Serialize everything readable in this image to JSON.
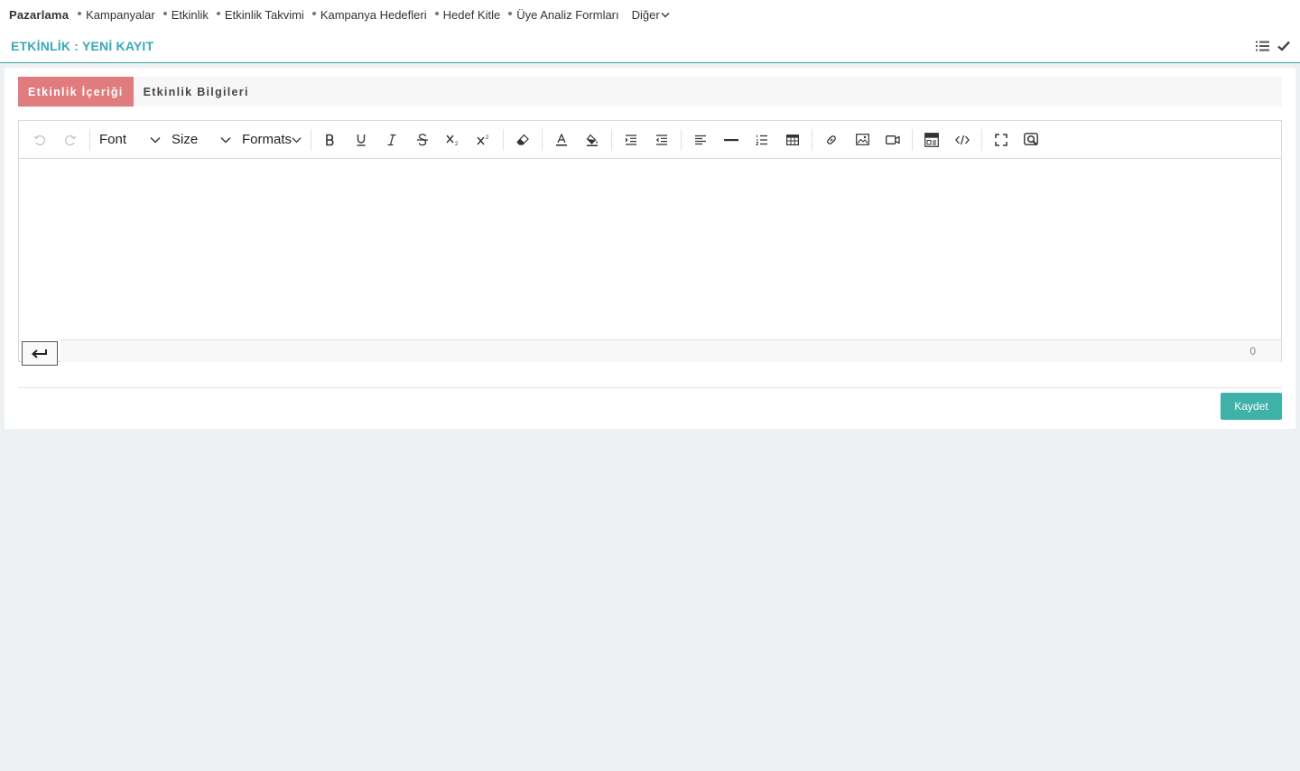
{
  "nav": {
    "brand": "Pazarlama",
    "items": [
      {
        "label": "Kampanyalar"
      },
      {
        "label": "Etkinlik"
      },
      {
        "label": "Etkinlik Takvimi"
      },
      {
        "label": "Kampanya Hedefleri"
      },
      {
        "label": "Hedef Kitle"
      },
      {
        "label": "Üye Analiz Formları"
      }
    ],
    "more_label": "Diğer"
  },
  "header": {
    "title": "ETKİNLİK : YENİ KAYIT",
    "actions": [
      "list-icon",
      "check-icon"
    ]
  },
  "tabs": [
    {
      "label": "Etkinlik İçeriği",
      "active": true
    },
    {
      "label": "Etkinlik Bilgileri",
      "active": false
    }
  ],
  "editor": {
    "font_label": "Font",
    "size_label": "Size",
    "formats_label": "Formats",
    "char_count": "0",
    "toolbar_icons": [
      "undo-icon",
      "redo-icon",
      "bold-icon",
      "underline-icon",
      "italic-icon",
      "strikethrough-icon",
      "subscript-icon",
      "superscript-icon",
      "eraser-icon",
      "font-color-icon",
      "highlight-icon",
      "indent-icon",
      "outdent-icon",
      "align-left-icon",
      "horizontal-rule-icon",
      "ordered-list-icon",
      "table-icon",
      "link-icon",
      "image-icon",
      "video-icon",
      "template-icon",
      "code-view-icon",
      "fullscreen-icon",
      "preview-icon"
    ]
  },
  "footer": {
    "save_label": "Kaydet"
  },
  "colors": {
    "accent_teal": "#38a9b5",
    "active_tab": "#e07b7e",
    "save_button": "#3fb1a8",
    "background": "#edf1f4"
  }
}
